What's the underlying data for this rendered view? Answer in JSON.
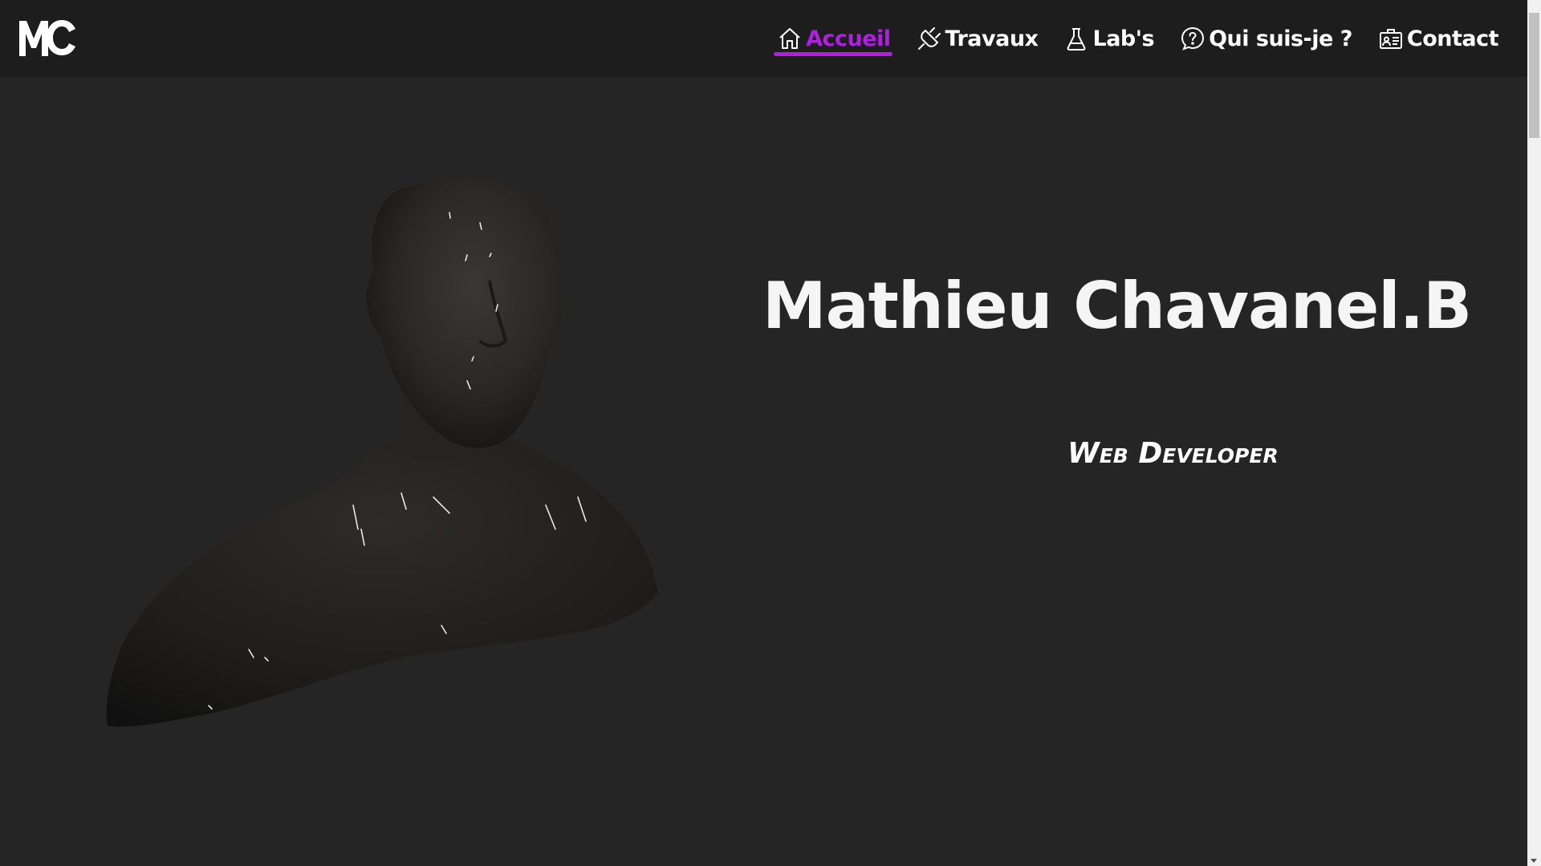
{
  "logo": {
    "text": "MC"
  },
  "nav": {
    "items": [
      {
        "label": "Accueil",
        "icon": "home-icon",
        "active": true
      },
      {
        "label": "Travaux",
        "icon": "plug-icon",
        "active": false
      },
      {
        "label": "Lab's",
        "icon": "flask-icon",
        "active": false
      },
      {
        "label": "Qui suis-je ?",
        "icon": "question-icon",
        "active": false
      },
      {
        "label": "Contact",
        "icon": "contact-card-icon",
        "active": false
      }
    ]
  },
  "hero": {
    "name": "Mathieu Chavanel.B",
    "role": "Web Developer",
    "image": "3d-bust-model"
  },
  "colors": {
    "background": "#252525",
    "navbar": "#1d1d1d",
    "accent": "#b01ee0",
    "text": "#ffffff"
  }
}
